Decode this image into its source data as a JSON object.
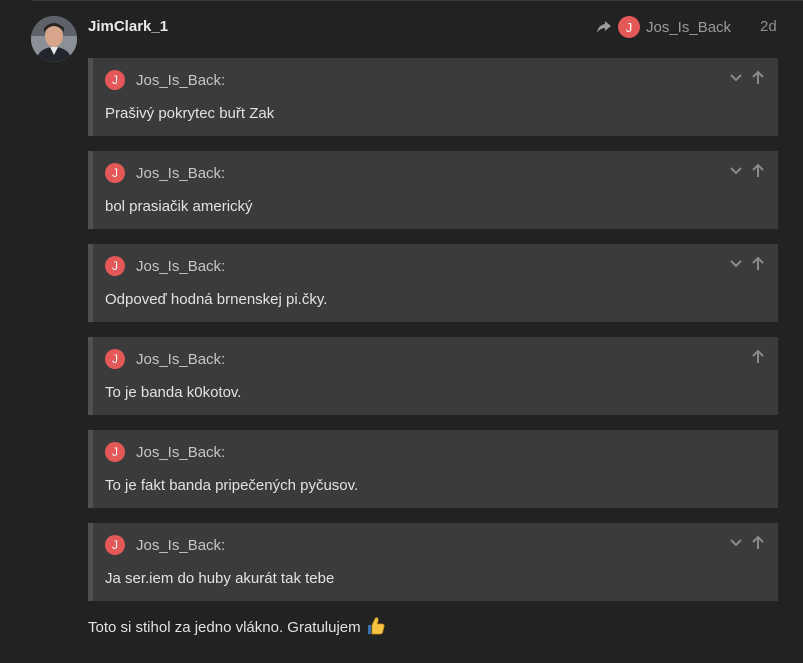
{
  "post": {
    "username": "JimClark_1",
    "reply_to": {
      "avatar_letter": "J",
      "name": "Jos_Is_Back",
      "avatar_color": "#e45858"
    },
    "date": "2d",
    "quotes": [
      {
        "avatar_letter": "J",
        "author": "Jos_Is_Back:",
        "text": "Prašivý pokrytec buřt Zak",
        "show_collapse": true
      },
      {
        "avatar_letter": "J",
        "author": "Jos_Is_Back:",
        "text": "bol prasiačik americký",
        "show_collapse": true
      },
      {
        "avatar_letter": "J",
        "author": "Jos_Is_Back:",
        "text": "Odpoveď hodná brnenskej pi.čky.",
        "show_collapse": true
      },
      {
        "avatar_letter": "J",
        "author": "Jos_Is_Back:",
        "text": "To je banda k0kotov.",
        "show_collapse": false
      },
      {
        "avatar_letter": "J",
        "author": "Jos_Is_Back:",
        "text": "To je fakt banda pripečených pyčusov.",
        "show_collapse": false
      },
      {
        "avatar_letter": "J",
        "author": "Jos_Is_Back:",
        "text": "Ja ser.iem do huby akurát tak tebe",
        "show_collapse": true
      }
    ],
    "closing_text": "Toto si stihol za jedno vlákno. Gratulujem",
    "closing_emoji": "thumbs-up-icon"
  },
  "colors": {
    "background": "#222222",
    "quote_bg": "#3b3b3b",
    "quote_border": "#505050",
    "avatar_red": "#e45858"
  }
}
